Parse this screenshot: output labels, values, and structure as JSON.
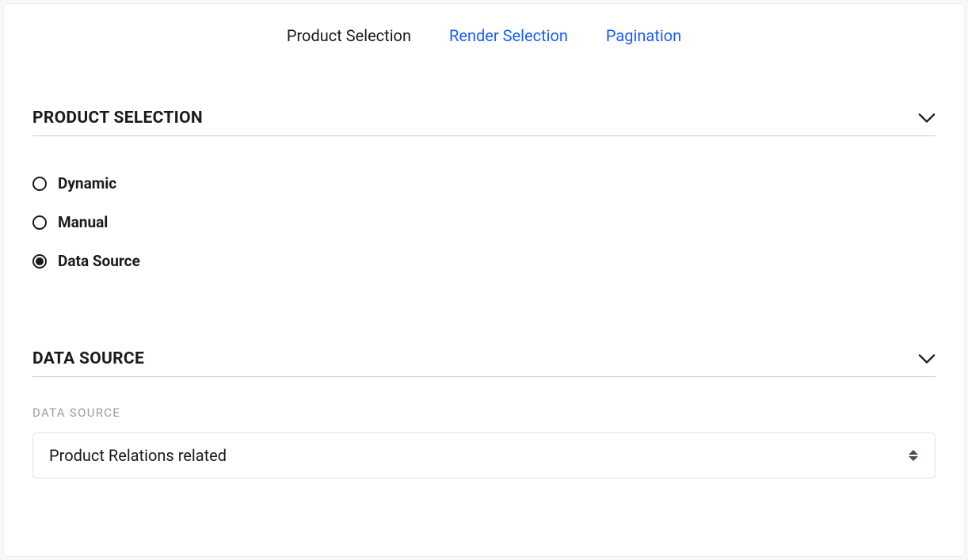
{
  "tabs": [
    {
      "label": "Product Selection",
      "active": true
    },
    {
      "label": "Render Selection",
      "active": false
    },
    {
      "label": "Pagination",
      "active": false
    }
  ],
  "section_product_selection": {
    "title": "PRODUCT SELECTION",
    "options": [
      {
        "label": "Dynamic",
        "selected": false
      },
      {
        "label": "Manual",
        "selected": false
      },
      {
        "label": "Data Source",
        "selected": true
      }
    ]
  },
  "section_data_source": {
    "title": "DATA SOURCE",
    "field_label": "DATA SOURCE",
    "selected_value": "Product Relations related"
  },
  "colors": {
    "link": "#1a5cff",
    "text": "#1a1a1a",
    "muted": "#9a9a9a",
    "border": "#e2e2e2"
  }
}
